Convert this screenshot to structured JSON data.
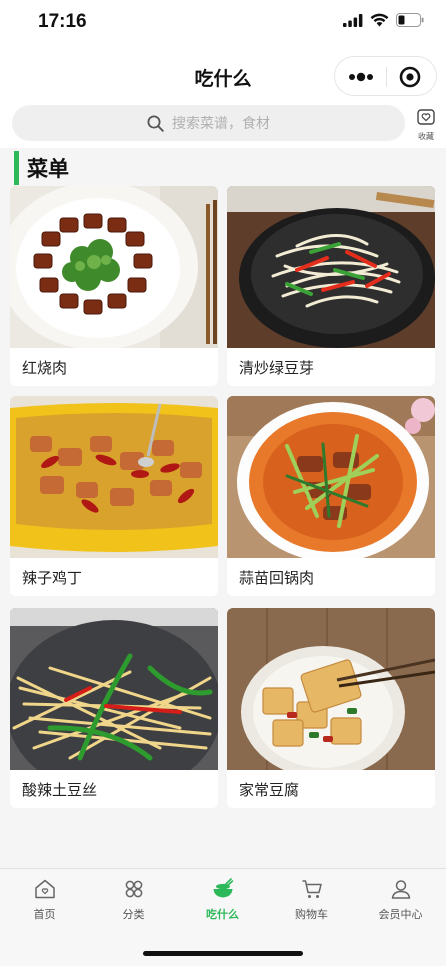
{
  "status_bar": {
    "time": "17:16"
  },
  "nav": {
    "title": "吃什么"
  },
  "search": {
    "placeholder": "搜索菜谱，食材"
  },
  "favorites": {
    "label": "收藏"
  },
  "section": {
    "title": "菜单"
  },
  "dishes": [
    {
      "name": "红烧肉"
    },
    {
      "name": "清炒绿豆芽"
    },
    {
      "name": "辣子鸡丁"
    },
    {
      "name": "蒜苗回锅肉"
    },
    {
      "name": "酸辣土豆丝"
    },
    {
      "name": "家常豆腐"
    }
  ],
  "tabbar": {
    "items": [
      {
        "label": "首页",
        "icon": "home-icon"
      },
      {
        "label": "分类",
        "icon": "category-icon"
      },
      {
        "label": "吃什么",
        "icon": "bowl-icon",
        "active": true
      },
      {
        "label": "购物车",
        "icon": "cart-icon"
      },
      {
        "label": "会员中心",
        "icon": "user-icon"
      }
    ]
  },
  "colors": {
    "accent": "#2db85a",
    "background": "#f5f5f5"
  }
}
